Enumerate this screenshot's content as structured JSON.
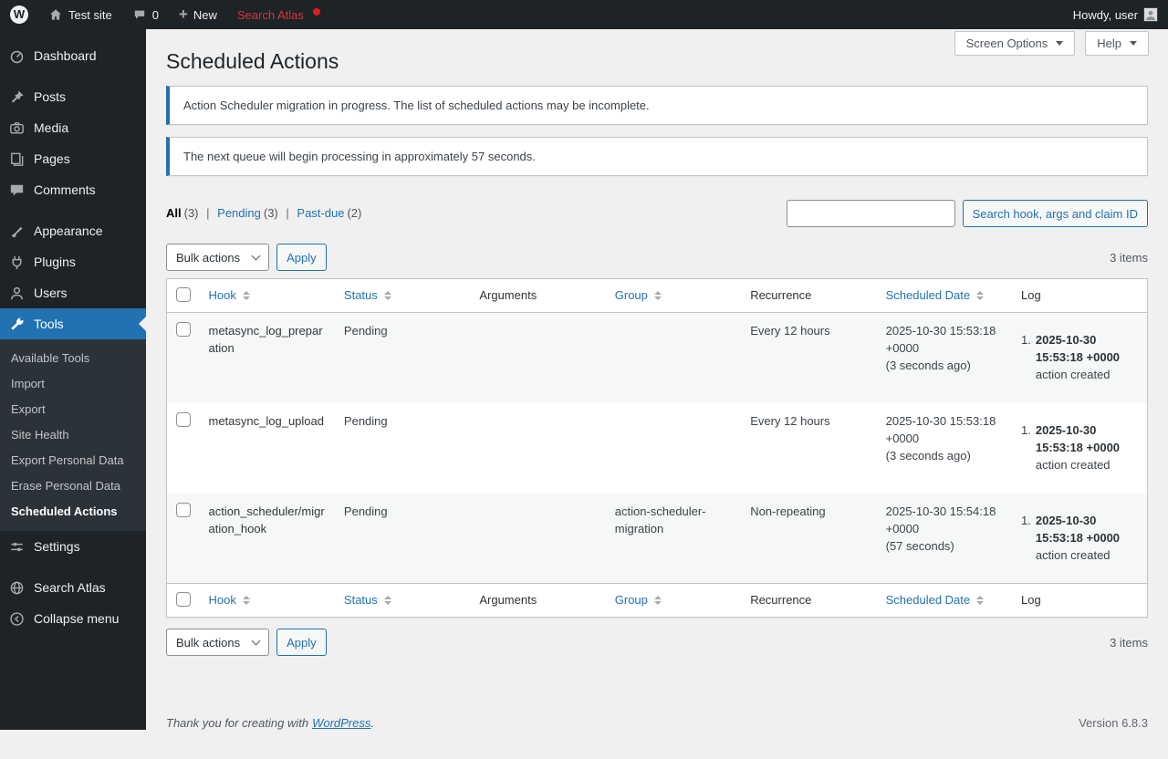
{
  "colors": {
    "admin_bar_bg": "#1d2327",
    "sidebar_bg": "#1d2327",
    "submenu_bg": "#2c3338",
    "active_menu_blue": "#2271b1",
    "link_blue": "#2271b1",
    "notice_border_blue": "#2271b1",
    "search_atlas_red": "#d63638",
    "badge_red": "#e01e1e",
    "content_bg": "#f0f0f1",
    "stripe_row": "#f6f7f7"
  },
  "admin_bar": {
    "logo_glyph": "W",
    "site_name": "Test site",
    "comments_count": "0",
    "new_icon_glyph": "+",
    "new_label": "New",
    "search_atlas_label": "Search Atlas",
    "howdy": "Howdy, user"
  },
  "sidebar": {
    "items": [
      {
        "label": "Dashboard"
      },
      {
        "label": "Posts"
      },
      {
        "label": "Media"
      },
      {
        "label": "Pages"
      },
      {
        "label": "Comments"
      },
      {
        "label": "Appearance"
      },
      {
        "label": "Plugins"
      },
      {
        "label": "Users"
      },
      {
        "label": "Tools"
      },
      {
        "label": "Settings"
      },
      {
        "label": "Search Atlas"
      },
      {
        "label": "Collapse menu"
      }
    ],
    "tools_submenu": [
      {
        "label": "Available Tools"
      },
      {
        "label": "Import"
      },
      {
        "label": "Export"
      },
      {
        "label": "Site Health"
      },
      {
        "label": "Export Personal Data"
      },
      {
        "label": "Erase Personal Data"
      },
      {
        "label": "Scheduled Actions"
      }
    ]
  },
  "screen_meta": {
    "screen_options_label": "Screen Options",
    "help_label": "Help"
  },
  "main": {
    "page_title": "Scheduled Actions",
    "notices": [
      {
        "text": "Action Scheduler migration in progress. The list of scheduled actions may be incomplete."
      },
      {
        "text": "The next queue will begin processing in approximately 57 seconds."
      }
    ],
    "filters": [
      {
        "label": "All",
        "count": "(3)"
      },
      {
        "label": "Pending",
        "count": "(3)"
      },
      {
        "label": "Past-due",
        "count": "(2)"
      }
    ],
    "filter_separator": "|",
    "search": {
      "value": "",
      "button_label": "Search hook, args and claim ID"
    },
    "bulk_actions_label": "Bulk actions",
    "apply_label": "Apply",
    "items_count": "3 items",
    "table": {
      "columns": [
        {
          "label": "Hook",
          "sortable": true
        },
        {
          "label": "Status",
          "sortable": true
        },
        {
          "label": "Arguments",
          "sortable": false
        },
        {
          "label": "Group",
          "sortable": true
        },
        {
          "label": "Recurrence",
          "sortable": false
        },
        {
          "label": "Scheduled Date",
          "sortable": true
        },
        {
          "label": "Log",
          "sortable": false
        }
      ],
      "rows": [
        {
          "hook": "metasync_log_preparation",
          "status": "Pending",
          "arguments": "",
          "group": "",
          "recurrence": "Every 12 hours",
          "scheduled_date": "2025-10-30 15:53:18 +0000",
          "scheduled_relative": "(3 seconds ago)",
          "log_number": "1.",
          "log_date": "2025-10-30 15:53:18 +0000",
          "log_action": "action created"
        },
        {
          "hook": "metasync_log_upload",
          "status": "Pending",
          "arguments": "",
          "group": "",
          "recurrence": "Every 12 hours",
          "scheduled_date": "2025-10-30 15:53:18 +0000",
          "scheduled_relative": "(3 seconds ago)",
          "log_number": "1.",
          "log_date": "2025-10-30 15:53:18 +0000",
          "log_action": "action created"
        },
        {
          "hook": "action_scheduler/migration_hook",
          "status": "Pending",
          "arguments": "",
          "group": "action-scheduler-migration",
          "recurrence": "Non-repeating",
          "scheduled_date": "2025-10-30 15:54:18 +0000",
          "scheduled_relative": "(57 seconds)",
          "log_number": "1.",
          "log_date": "2025-10-30 15:53:18 +0000",
          "log_action": "action created"
        }
      ]
    },
    "footer_left": {
      "prefix": "Thank you for creating with",
      "link": "WordPress",
      "suffix": "."
    },
    "footer_version": "Version 6.8.3"
  }
}
